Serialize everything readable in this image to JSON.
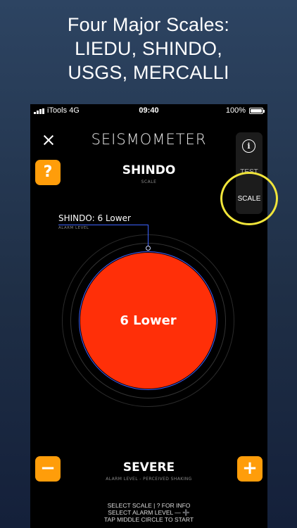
{
  "headline": [
    "Four Major Scales:",
    "LIEDU, SHINDO,",
    "USGS, MERCALLI"
  ],
  "status_bar": {
    "carrier": "iTools",
    "network": "4G",
    "time": "09:40",
    "battery": "100%"
  },
  "app": {
    "title": "SEISMOMETER",
    "help_label": "?",
    "scale": {
      "name": "SHINDO",
      "caption": "SCALE"
    },
    "side_menu": {
      "info_glyph": "i",
      "test_label": "TEST",
      "scale_label": "SCALE"
    },
    "alarm": {
      "label": "SHINDO: 6 Lower",
      "caption": "ALARM LEVEL"
    },
    "center_value": "6 Lower",
    "level": {
      "name": "SEVERE",
      "caption": "ALARM LEVEL - PERCEIVED SHAKING"
    },
    "minus_label": "−",
    "plus_label": "+",
    "instructions": [
      "SELECT SCALE | ? FOR INFO",
      "SELECT ALARM LEVEL — ➕",
      "TAP MIDDLE CIRCLE TO START"
    ]
  },
  "colors": {
    "accent_orange": "#ff9d0a",
    "alarm_red": "#ff2f08",
    "highlight_yellow": "#f1e53a",
    "indicator_blue": "#4060ff"
  }
}
